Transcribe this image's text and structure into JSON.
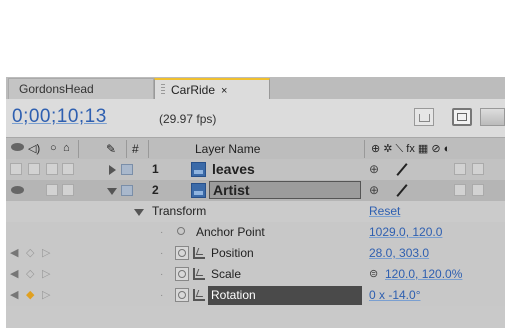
{
  "tabs": [
    {
      "label": "GordonsHead"
    },
    {
      "label": "CarRide",
      "close": "×"
    }
  ],
  "toolbar": {
    "timecode": "0;00;10;13",
    "fps": "(29.97 fps)"
  },
  "header": {
    "hash": "#",
    "layer_name": "Layer Name",
    "switches": "⊕ ✲ ⟍ fx ▦ ⊘ ◐"
  },
  "layers": [
    {
      "number": "1",
      "name": "leaves"
    },
    {
      "number": "2",
      "name": "Artist"
    }
  ],
  "transform": {
    "label": "Transform",
    "reset": "Reset",
    "properties": [
      {
        "name": "Anchor Point",
        "value": "1029.0, 120.0"
      },
      {
        "name": "Position",
        "value": "28.0, 303.0"
      },
      {
        "name": "Scale",
        "value": "120.0, 120.0%"
      },
      {
        "name": "Rotation",
        "value": "0 x -14.0°"
      }
    ]
  },
  "colors": {
    "accent_blue": "#2e5fb0",
    "tab_highlight": "#f0c030",
    "selected_row": "#b5b5b5"
  }
}
